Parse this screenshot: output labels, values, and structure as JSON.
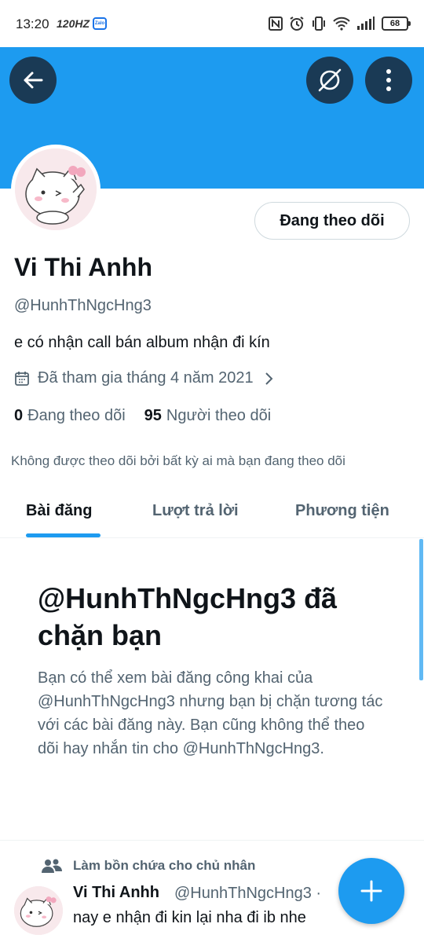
{
  "status_bar": {
    "time": "13:20",
    "refresh_rate": "120HZ",
    "zalo_badge": "Zalo",
    "battery": "68"
  },
  "colors": {
    "accent": "#1d9bf0",
    "banner": "#1d9bf0",
    "header_button": "#1a3a55"
  },
  "header": {
    "back_icon": "arrow-left-icon",
    "explore_icon": "compass-slash-icon",
    "more_icon": "vertical-dots-icon"
  },
  "profile": {
    "follow_button": "Đang theo dõi",
    "display_name": "Vi Thi Anhh",
    "handle": "@HunhThNgcHng3",
    "bio": "e có nhận call bán album nhận đi kín",
    "joined": "Đã tham gia tháng 4 năm 2021",
    "following_count": "0",
    "following_label": "Đang theo dõi",
    "followers_count": "95",
    "followers_label": "Người theo dõi",
    "not_followed_notice": "Không được theo dõi bởi bất kỳ ai mà bạn đang theo dõi"
  },
  "tabs": [
    {
      "label": "Bài đăng",
      "active": true
    },
    {
      "label": "Lượt trả lời",
      "active": false
    },
    {
      "label": "Phương tiện",
      "active": false
    }
  ],
  "blocked": {
    "title": "@HunhThNgcHng3 đã chặn bạn",
    "description": "Bạn có thể xem bài đăng công khai của @HunhThNgcHng3 nhưng bạn bị chặn tương tác với các bài đăng này. Bạn cũng không thể theo dõi hay nhắn tin cho @HunhThNgcHng3."
  },
  "tweet": {
    "context": "Làm bồn chứa cho chủ nhân",
    "name": "Vi Thi Anhh",
    "handle": "@HunhThNgcHng3 ·",
    "text": "nay e nhận đi kin lại nha đi ib nhe"
  },
  "fab": {
    "icon": "plus-icon"
  }
}
